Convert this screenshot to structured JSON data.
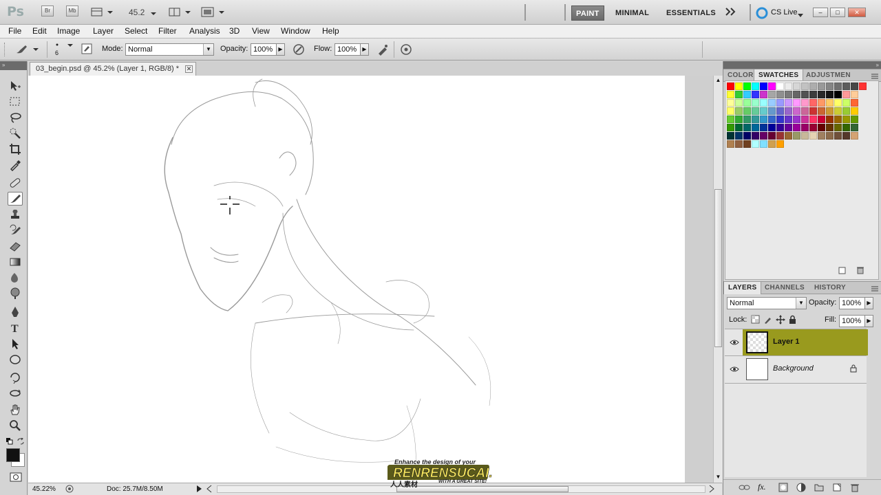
{
  "appbar": {
    "logo": "Ps",
    "bridge_label": "Br",
    "minibridge_label": "Mb",
    "zoom_value": "45.2",
    "workspaces": [
      "PAINT",
      "MINIMAL",
      "ESSENTIALS"
    ],
    "active_workspace": "PAINT",
    "cs_live": "CS Live"
  },
  "menu": [
    "File",
    "Edit",
    "Image",
    "Layer",
    "Select",
    "Filter",
    "Analysis",
    "3D",
    "View",
    "Window",
    "Help"
  ],
  "options": {
    "brush_size": "6",
    "mode_label": "Mode:",
    "mode_value": "Normal",
    "opacity_label": "Opacity:",
    "opacity_value": "100%",
    "flow_label": "Flow:",
    "flow_value": "100%"
  },
  "document": {
    "tab_title": "03_begin.psd @ 45.2% (Layer 1, RGB/8) *",
    "zoom_status": "45.22%",
    "doc_size": "Doc: 25.7M/8.50M"
  },
  "panels": {
    "top_tabs": [
      "COLOR",
      "SWATCHES",
      "ADJUSTMEN"
    ],
    "active_top_tab": "SWATCHES",
    "layers_tabs": [
      "LAYERS",
      "CHANNELS",
      "HISTORY"
    ],
    "active_layers_tab": "LAYERS",
    "blend_mode": "Normal",
    "opacity_label": "Opacity:",
    "opacity_value": "100%",
    "lock_label": "Lock:",
    "fill_label": "Fill:",
    "fill_value": "100%",
    "layers": [
      {
        "name": "Layer 1",
        "selected": true,
        "visible": true
      },
      {
        "name": "Background",
        "selected": false,
        "visible": true,
        "locked": true
      }
    ]
  },
  "swatch_colors": [
    [
      "#ff0000",
      "#ffff00",
      "#00ff00",
      "#00ffff",
      "#0000ff",
      "#ff00ff",
      "#ffffff",
      "#ebebeb",
      "#d6d6d6",
      "#c2c2c2",
      "#adadad",
      "#999999",
      "#858585",
      "#707070",
      "#5c5c5c",
      "#474747",
      "#ff3333"
    ],
    [
      "#ffff33",
      "#33cc33",
      "#33ccff",
      "#3333ff",
      "#cc33cc",
      "#a6a6a6",
      "#8f8f8f",
      "#7a7a7a",
      "#666666",
      "#525252",
      "#3d3d3d",
      "#292929",
      "#141414",
      "#000000",
      "#ff9999",
      "#ffcc99"
    ],
    [
      "#ffff99",
      "#ccff99",
      "#99ff99",
      "#99ffcc",
      "#99ffff",
      "#99ccff",
      "#9999ff",
      "#cc99ff",
      "#ff99ff",
      "#ff99cc",
      "#ff6666",
      "#ff9966",
      "#ffcc66",
      "#ffff66",
      "#ccff66",
      "#ff6633"
    ],
    [
      "#ffff66",
      "#99cc66",
      "#66cc66",
      "#66cc99",
      "#66cccc",
      "#6699cc",
      "#6666cc",
      "#9966cc",
      "#cc66cc",
      "#cc6699",
      "#cc3333",
      "#cc6633",
      "#cc9933",
      "#cccc33",
      "#99cc33",
      "#ffcc00"
    ],
    [
      "#66cc33",
      "#33aa33",
      "#339966",
      "#339999",
      "#3399cc",
      "#3366cc",
      "#3333cc",
      "#6633cc",
      "#9933cc",
      "#cc3399",
      "#ff3366",
      "#cc0033",
      "#993300",
      "#996600",
      "#999900",
      "#669900"
    ],
    [
      "#339900",
      "#006633",
      "#006666",
      "#006699",
      "#003399",
      "#000099",
      "#330099",
      "#660099",
      "#990099",
      "#990066",
      "#990033",
      "#660000",
      "#663300",
      "#666600",
      "#336600",
      "#336633"
    ],
    [
      "#003333",
      "#003366",
      "#000066",
      "#330066",
      "#660066",
      "#660033",
      "#993333",
      "#996633",
      "#999966",
      "#c8b89a",
      "#e5d3b3",
      "#a08060",
      "#8c6a4a",
      "#70503a",
      "#54382a",
      "#d4a373"
    ],
    [
      "#b08050",
      "#906040",
      "#704020",
      "#b0ffff",
      "#80e0ff",
      "#d0a050",
      "#ffa000"
    ]
  ],
  "icons": {
    "brush_tool": "brush-icon",
    "eye": "eye-icon",
    "lock": "lock-icon"
  }
}
